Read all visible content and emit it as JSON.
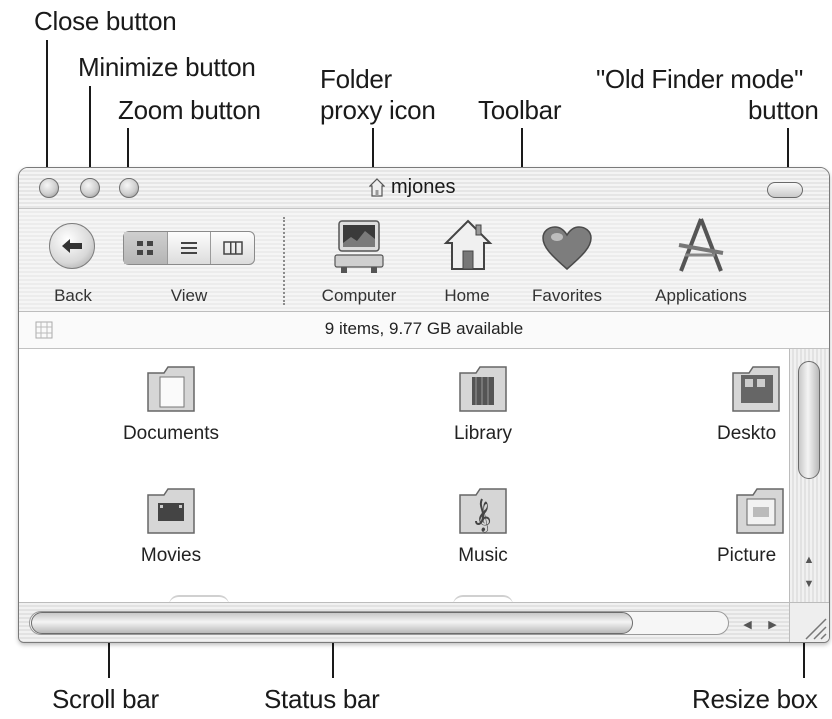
{
  "callouts": {
    "close": "Close button",
    "minimize": "Minimize button",
    "zoom": "Zoom button",
    "proxy_line1": "Folder",
    "proxy_line2": "proxy icon",
    "toolbar": "Toolbar",
    "oldfinder_line1": "\"Old Finder mode\"",
    "oldfinder_line2": "button",
    "scrollbar": "Scroll bar",
    "statusbar": "Status bar",
    "resize": "Resize box"
  },
  "window": {
    "title": "mjones"
  },
  "toolbar": {
    "back_label": "Back",
    "view_label": "View",
    "computer_label": "Computer",
    "home_label": "Home",
    "favorites_label": "Favorites",
    "applications_label": "Applications"
  },
  "status": {
    "text": "9 items, 9.77 GB available"
  },
  "items": [
    {
      "label": "Documents"
    },
    {
      "label": "Library"
    },
    {
      "label": "Deskto"
    },
    {
      "label": "Movies"
    },
    {
      "label": "Music"
    },
    {
      "label": "Picture"
    }
  ]
}
